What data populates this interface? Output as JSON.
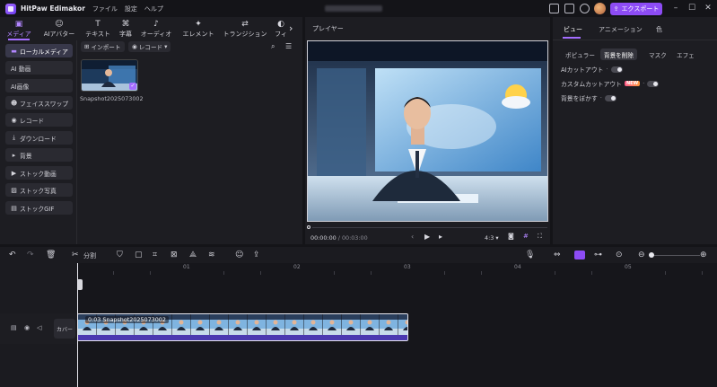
{
  "titlebar": {
    "app_name": "HitPaw Edimakor",
    "menus": [
      "ファイル",
      "設定",
      "ヘルプ"
    ],
    "export_label": "エクスポート"
  },
  "toolbar": {
    "tabs": [
      {
        "label": "メディア",
        "icon": "media-icon",
        "active": true
      },
      {
        "label": "AIアバター",
        "icon": "ai-avatar-icon"
      },
      {
        "label": "テキスト",
        "icon": "text-icon"
      },
      {
        "label": "字幕",
        "icon": "subtitle-icon"
      },
      {
        "label": "オーディオ",
        "icon": "audio-icon"
      },
      {
        "label": "エレメント",
        "icon": "element-icon"
      },
      {
        "label": "トランジション",
        "icon": "transition-icon"
      },
      {
        "label": "フィ",
        "icon": "filter-icon"
      }
    ]
  },
  "sidebar": {
    "items": [
      {
        "label": "ローカルメディア",
        "icon": "folder-icon",
        "active": true
      },
      {
        "label": "AI 動画",
        "icon": "ai-video-icon"
      },
      {
        "label": "AI画像",
        "icon": "ai-image-icon"
      },
      {
        "label": "フェイススワップ",
        "icon": "face-swap-icon"
      },
      {
        "label": "レコード",
        "icon": "record-icon"
      },
      {
        "label": "ダウンロード",
        "icon": "download-icon"
      },
      {
        "label": "背景",
        "icon": "background-icon"
      },
      {
        "label": "ストック動画",
        "icon": "stock-video-icon"
      },
      {
        "label": "ストック写真",
        "icon": "stock-photo-icon"
      },
      {
        "label": "ストックGIF",
        "icon": "stock-gif-icon"
      }
    ]
  },
  "media": {
    "import_label": "インポート",
    "record_label": "レコード",
    "item_name": "Snapshot2025073002"
  },
  "player": {
    "title": "プレイヤー",
    "current_time": "00:00:00",
    "separator": "/",
    "total_time": "00:03:00",
    "aspect": "4:3"
  },
  "inspector": {
    "tabs": [
      "ビュー",
      "アニメーション",
      "色"
    ],
    "subtabs": [
      "ポピュラー",
      "背景を削除",
      "マスク",
      "エフェ"
    ],
    "rows": [
      {
        "label": "AIカットアウト"
      },
      {
        "label": "カスタムカットアウト",
        "badge": "NEW"
      },
      {
        "label": "背景をぼかす"
      }
    ]
  },
  "timeline": {
    "split_label": "分割",
    "ruler": [
      "01",
      "02",
      "03",
      "04",
      "05"
    ],
    "cover_label": "カバー",
    "clip_label": "0:03 Snapshot2025073002"
  },
  "colors": {
    "accent": "#8d4cf5",
    "clip": "#5c48c4"
  }
}
